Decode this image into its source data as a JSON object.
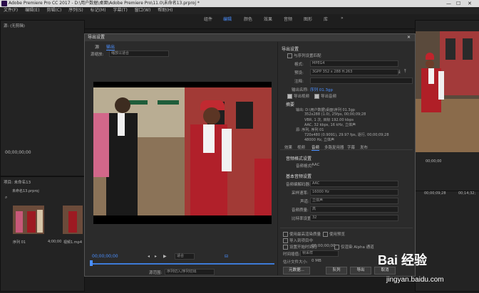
{
  "window": {
    "title": "Adobe Premiere Pro CC 2017 - D:\\用户数据\\桌面\\Adobe Premiere Pro\\11.0\\未命名13.prproj *",
    "minimize": "—",
    "maximize": "☐",
    "close": "✕"
  },
  "menu": [
    "文件(F)",
    "编辑(E)",
    "剪辑(C)",
    "序列(S)",
    "标记(M)",
    "字幕(T)",
    "窗口(W)",
    "帮助(H)"
  ],
  "workspaces": [
    "组件",
    "编辑",
    "颜色",
    "效果",
    "音频",
    "图形",
    "库"
  ],
  "active_workspace": "编辑",
  "left_panel": {
    "source_tab": "源: (无剪辑)",
    "timecode": "00;00;00;00",
    "project_tab": "项目: 未命名13",
    "project_file": "未命名13.prproj",
    "clip1_name": "序列 01",
    "clip1_dur": "4;00;00",
    "clip2_name": "视频1.mp4",
    "clip2_dur": "0;09;28"
  },
  "right_panel": {
    "tc1": "00;00;00",
    "tc2": "00;00;09;28",
    "tc3": "00;14;32;"
  },
  "dialog": {
    "title": "导出设置",
    "tab_source": "源",
    "tab_output": "输出",
    "source_scaling_label": "源缩放:",
    "source_scaling_value": "缩放以适合",
    "timecode_left": "00;00;00;00",
    "fit_label": "适合",
    "source_range_label": "源范围:",
    "source_range_value": "序列切入/序列切出",
    "export_settings": {
      "header": "导出设置",
      "match_seq": "与序列设置匹配",
      "format_label": "格式:",
      "format_value": "MPEG4",
      "preset_label": "预设:",
      "preset_value": "3GPP 352 x 288 H.263",
      "comments_label": "注释:",
      "output_name_label": "输出名称:",
      "output_name_value": "序列 01.3gp",
      "export_video": "导出视频",
      "export_audio": "导出音频"
    },
    "summary": {
      "header": "摘要",
      "output": "输出: D:\\用户数据\\桌面\\序列 01.3gp",
      "line1": "352x288 (1.0), 25fps, 00;00;09;28",
      "line2": "VBR, 1 次, 目标 192.00 kbps",
      "line3": "AAC, 32 kbps, 16 kHz, 立体声",
      "source": "源: 序列, 序列 01",
      "src1": "720x480 (0.9091), 29.97 fps, 逐行, 00;00;09;28",
      "src2": "48000 Hz, 立体声"
    },
    "tabs": [
      "效果",
      "视频",
      "音频",
      "多路复用器",
      "字幕",
      "发布"
    ],
    "active_tab": "音频",
    "audio_format": {
      "header": "音频格式设置",
      "label": "音频格式:",
      "value": "AAC"
    },
    "basic_audio": {
      "header": "基本音频设置",
      "codec_label": "音频编解码器:",
      "codec_value": "AAC",
      "rate_label": "采样速率:",
      "rate_value": "16000 Hz",
      "channels_label": "声道:",
      "channels_value": "立体声",
      "quality_label": "音频质量:",
      "quality_value": "高",
      "bitrate_label": "比特率设置",
      "bitrate_value": "32"
    },
    "options": {
      "max_render": "使用最高渲染质量",
      "use_preview": "使用预览",
      "import_project": "导入到项目中",
      "set_tc": "设置开始时间码",
      "tc_value": "00;00;00;00",
      "render_alpha": "仅渲染 Alpha 通道",
      "time_interp_label": "时间插值:",
      "time_interp_value": "帧采样",
      "est_size_label": "估计文件大小:",
      "est_size_value": "0 MB"
    },
    "buttons": {
      "metadata": "元数据...",
      "queue": "队列",
      "export": "导出",
      "cancel": "取消"
    }
  },
  "watermark": {
    "brand": "Bai 经验",
    "url": "jingyan.baidu.com"
  }
}
